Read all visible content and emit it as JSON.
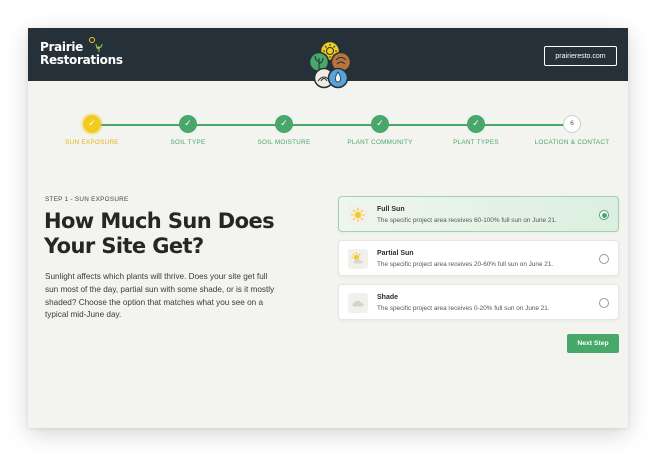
{
  "header": {
    "brand_line1": "Prairie",
    "brand_line2": "Restorations",
    "website_button": "prairieresto.com"
  },
  "stepper": {
    "steps": [
      {
        "label": "SUN EXPOSURE",
        "state": "active",
        "marker": "✓"
      },
      {
        "label": "SOIL TYPE",
        "state": "complete",
        "marker": "✓"
      },
      {
        "label": "SOIL MOISTURE",
        "state": "complete",
        "marker": "✓"
      },
      {
        "label": "PLANT COMMUNITY",
        "state": "complete",
        "marker": "✓"
      },
      {
        "label": "PLANT TYPES",
        "state": "complete",
        "marker": "✓"
      },
      {
        "label": "LOCATION & CONTACT",
        "state": "pending",
        "marker": "6"
      }
    ]
  },
  "main": {
    "kicker": "STEP 1 - SUN EXPOSURE",
    "title": "How Much Sun Does Your Site Get?",
    "description": "Sunlight affects which plants will thrive. Does your site get full sun most of the day, partial sun with some shade, or is it mostly shaded? Choose the option that matches what you see on a typical mid-June day."
  },
  "options": [
    {
      "icon": "sun-icon",
      "title": "Full Sun",
      "description": "The specific project area receives 60-100% full sun on June 21.",
      "selected": true
    },
    {
      "icon": "partial-sun-icon",
      "title": "Partial Sun",
      "description": "The specific project area receives 20-60% full sun on June 21.",
      "selected": false
    },
    {
      "icon": "cloud-icon",
      "title": "Shade",
      "description": "The specific project area receives 0-20% full sun on June 21.",
      "selected": false
    }
  ],
  "actions": {
    "next_label": "Next Step"
  },
  "colors": {
    "header_bg": "#253038",
    "accent_green": "#48a86a",
    "accent_yellow": "#f2cc1f",
    "page_bg": "#f3f3ef"
  }
}
